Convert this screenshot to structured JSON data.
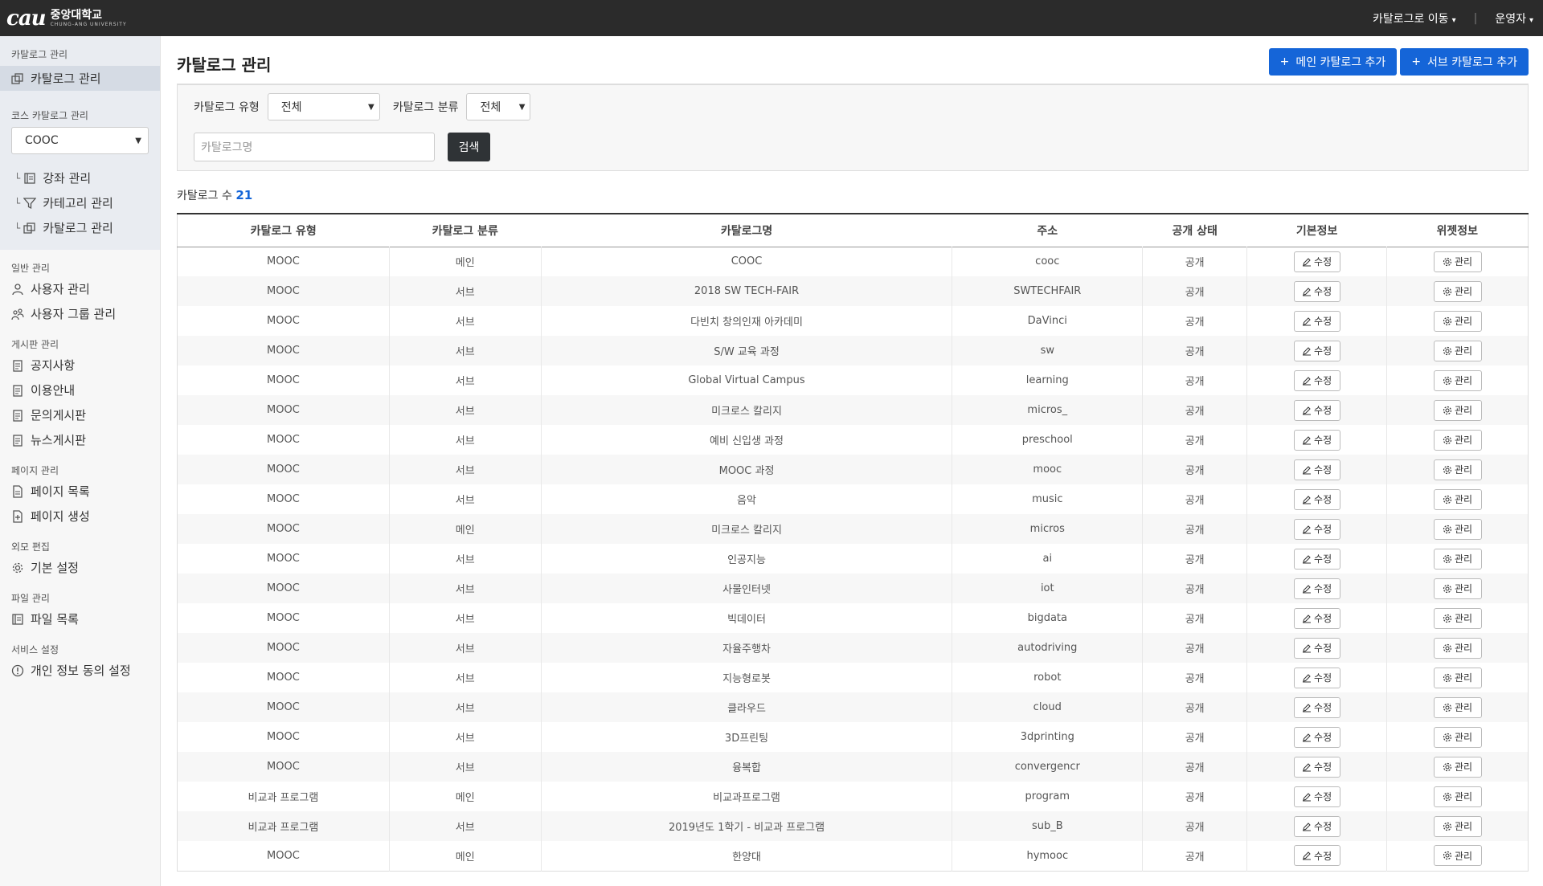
{
  "header": {
    "logo_mark": "cau",
    "logo_name": "중앙대학교",
    "logo_sub": "CHUNG-ANG UNIVERSITY",
    "nav_catalog": "카탈로그로 이동",
    "nav_user": "운영자"
  },
  "sidebar": {
    "catalog_head": "카탈로그 관리",
    "catalog_item": "카탈로그 관리",
    "course_head": "코스 카탈로그 관리",
    "course_select": "COOC",
    "course_items": [
      "강좌 관리",
      "카테고리 관리",
      "카탈로그 관리"
    ],
    "general_head": "일반 관리",
    "general_items": [
      "사용자 관리",
      "사용자 그룹 관리"
    ],
    "board_head": "게시판 관리",
    "board_items": [
      "공지사항",
      "이용안내",
      "문의게시판",
      "뉴스게시판"
    ],
    "page_head": "페이지 관리",
    "page_items": [
      "페이지 목록",
      "페이지 생성"
    ],
    "look_head": "외모 편집",
    "look_items": [
      "기본 설정"
    ],
    "file_head": "파일 관리",
    "file_items": [
      "파일 목록"
    ],
    "service_head": "서비스 설정",
    "service_items": [
      "개인 정보 동의 설정"
    ]
  },
  "main": {
    "title": "카탈로그 관리",
    "add_main": "메인 카탈로그 추가",
    "add_sub": "서브 카탈로그 추가",
    "filter_type_label": "카탈로그 유형",
    "filter_type_value": "전체",
    "filter_class_label": "카탈로그 분류",
    "filter_class_value": "전체",
    "search_placeholder": "카탈로그명",
    "search_button": "검색",
    "count_label": "카탈로그 수",
    "count_value": "21"
  },
  "table": {
    "headers": [
      "카탈로그 유형",
      "카탈로그 분류",
      "카탈로그명",
      "주소",
      "공개 상태",
      "기본정보",
      "위젯정보"
    ],
    "edit_label": "수정",
    "manage_label": "관리",
    "rows": [
      [
        "MOOC",
        "메인",
        "COOC",
        "cooc",
        "공개"
      ],
      [
        "MOOC",
        "서브",
        "2018 SW TECH-FAIR",
        "SWTECHFAIR",
        "공개"
      ],
      [
        "MOOC",
        "서브",
        "다빈치 창의인재 아카데미",
        "DaVinci",
        "공개"
      ],
      [
        "MOOC",
        "서브",
        "S/W 교육 과정",
        "sw",
        "공개"
      ],
      [
        "MOOC",
        "서브",
        "Global Virtual Campus",
        "learning",
        "공개"
      ],
      [
        "MOOC",
        "서브",
        "미크로스 칼리지",
        "micros_",
        "공개"
      ],
      [
        "MOOC",
        "서브",
        "예비 신입생 과정",
        "preschool",
        "공개"
      ],
      [
        "MOOC",
        "서브",
        "MOOC 과정",
        "mooc",
        "공개"
      ],
      [
        "MOOC",
        "서브",
        "음악",
        "music",
        "공개"
      ],
      [
        "MOOC",
        "메인",
        "미크로스 칼리지",
        "micros",
        "공개"
      ],
      [
        "MOOC",
        "서브",
        "인공지능",
        "ai",
        "공개"
      ],
      [
        "MOOC",
        "서브",
        "사물인터넷",
        "iot",
        "공개"
      ],
      [
        "MOOC",
        "서브",
        "빅데이터",
        "bigdata",
        "공개"
      ],
      [
        "MOOC",
        "서브",
        "자율주행차",
        "autodriving",
        "공개"
      ],
      [
        "MOOC",
        "서브",
        "지능형로봇",
        "robot",
        "공개"
      ],
      [
        "MOOC",
        "서브",
        "클라우드",
        "cloud",
        "공개"
      ],
      [
        "MOOC",
        "서브",
        "3D프린팅",
        "3dprinting",
        "공개"
      ],
      [
        "MOOC",
        "서브",
        "융복합",
        "convergencr",
        "공개"
      ],
      [
        "비교과 프로그램",
        "메인",
        "비교과프로그램",
        "program",
        "공개"
      ],
      [
        "비교과 프로그램",
        "서브",
        "2019년도 1학기 - 비교과 프로그램",
        "sub_B",
        "공개"
      ],
      [
        "MOOC",
        "메인",
        "한양대",
        "hymooc",
        "공개"
      ]
    ]
  },
  "colors": {
    "accent": "#1565d8",
    "topbar": "#2b2b2b"
  }
}
